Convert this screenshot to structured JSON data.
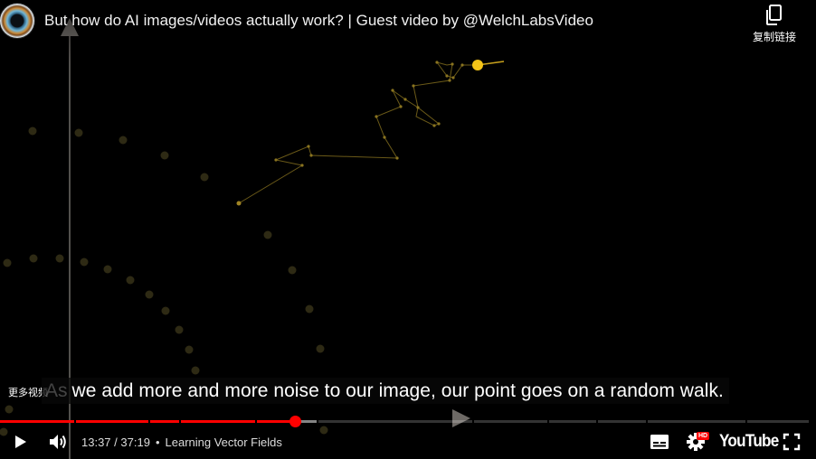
{
  "header": {
    "video_title": "But how do AI images/videos actually work? | Guest video by @WelchLabsVideo",
    "copy_link_label": "复制链接"
  },
  "overlay": {
    "more_videos_label": "更多视频"
  },
  "captions": {
    "prefix": "As",
    "text": "we add more and more noise to our image, our point goes on a random walk."
  },
  "progress": {
    "played_fraction": 0.365,
    "loaded_fraction": 0.393,
    "chapter_marks": [
      0.092,
      0.183,
      0.222,
      0.315,
      0.391,
      0.584,
      0.677,
      0.737,
      0.799,
      0.922
    ]
  },
  "controls": {
    "current_time": "13:37",
    "duration": "37:19",
    "time_separator": " / ",
    "chapter_title": "Learning Vector Fields",
    "logo_text": "YouTube",
    "hd_badge": "HD"
  },
  "icons": {
    "play": "play-icon",
    "volume": "volume-icon",
    "subtitles": "subtitles-icon",
    "settings": "gear-icon",
    "fullscreen": "fullscreen-icon",
    "copy": "copy-icon"
  },
  "colors": {
    "progress_played": "#ff0000",
    "walk_point": "#f5c518",
    "walk_line": "#7a6418",
    "scatter_dots": "#2e2a14",
    "axis": "#6e6a66"
  }
}
